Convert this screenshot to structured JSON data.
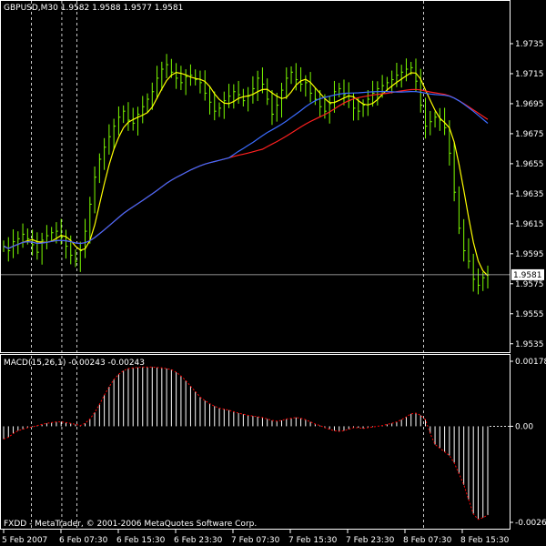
{
  "window_title": "GBPUSD,M30  1.9582 1.9588 1.9577 1.9581",
  "footer": "FXDD - MetaTrader, © 2001-2006 MetaQuotes Software Corp.",
  "colors": {
    "background": "#000000",
    "frame": "#ffffff",
    "bars": "#7CFC00",
    "ma_fast": "#ffff00",
    "ma_red": "#ff2020",
    "ma_blue": "#3b6cff",
    "macd_hist": "#ffffff",
    "macd_signal": "#ff0000",
    "current_price_line": "#c0c0c0",
    "grid_vlines": "#ffffff"
  },
  "chart_data": [
    {
      "type": "line",
      "title": "GBPUSD,M30  1.9582 1.9588 1.9577 1.9581",
      "ylim": [
        1.953,
        1.9755
      ],
      "y_ticks": [
        "1.9735",
        "1.9715",
        "1.9695",
        "1.9675",
        "1.9655",
        "1.9635",
        "1.9615",
        "1.9595",
        "1.9575",
        "1.9555",
        "1.9535"
      ],
      "current_price": "1.9581",
      "x_ticks": [
        "5 Feb 2007",
        "6 Feb 07:30",
        "6 Feb 15:30",
        "6 Feb 23:30",
        "7 Feb 07:30",
        "7 Feb 15:30",
        "7 Feb 23:30",
        "8 Feb 07:30",
        "8 Feb 15:30"
      ],
      "ohlc_close": [
        1.96,
        1.9597,
        1.9603,
        1.9605,
        1.9608,
        1.9605,
        1.9601,
        1.9596,
        1.9604,
        1.9607,
        1.9609,
        1.961,
        1.9606,
        1.96,
        1.9594,
        1.959,
        1.9597,
        1.961,
        1.9628,
        1.9646,
        1.9658,
        1.9666,
        1.9673,
        1.968,
        1.9686,
        1.969,
        1.9684,
        1.9682,
        1.9688,
        1.9693,
        1.9698,
        1.9703,
        1.9712,
        1.9718,
        1.9721,
        1.9716,
        1.9712,
        1.9709,
        1.9713,
        1.9714,
        1.9711,
        1.9709,
        1.9702,
        1.9696,
        1.969,
        1.9692,
        1.9697,
        1.97,
        1.9703,
        1.9701,
        1.9697,
        1.97,
        1.9705,
        1.9712,
        1.9708,
        1.9698,
        1.9688,
        1.9694,
        1.9704,
        1.9712,
        1.9716,
        1.9711,
        1.9708,
        1.9709,
        1.9702,
        1.9698,
        1.9693,
        1.969,
        1.9695,
        1.9703,
        1.9705,
        1.9701,
        1.9697,
        1.9692,
        1.969,
        1.9694,
        1.9698,
        1.9702,
        1.9705,
        1.9707,
        1.9709,
        1.9711,
        1.9714,
        1.9716,
        1.9718,
        1.9719,
        1.971,
        1.9694,
        1.968,
        1.9683,
        1.9686,
        1.9684,
        1.9679,
        1.9662,
        1.9636,
        1.9612,
        1.9597,
        1.959,
        1.9578,
        1.9574,
        1.9579,
        1.9581
      ],
      "bar_range": 0.0011,
      "series": [
        {
          "period": 5,
          "color_key": "ma_fast"
        },
        {
          "period": 55,
          "color_key": "ma_red"
        },
        {
          "period": 48,
          "color_key": "ma_blue"
        }
      ]
    },
    {
      "type": "bar",
      "title": "MACD(15,26,1) -0.00243 -0.00243",
      "ylim": [
        -0.00263,
        0.00178
      ],
      "y_ticks": [
        "0.00178",
        "0.00",
        "-0.00263"
      ],
      "histogram": [
        -0.00035,
        -0.0003,
        -0.0002,
        -0.00012,
        -8e-05,
        -4e-05,
        -2e-05,
        2e-05,
        5e-05,
        8e-05,
        0.0001,
        0.00012,
        0.00012,
        0.0001,
        8e-05,
        5e-05,
        2e-05,
        8e-05,
        0.0002,
        0.00038,
        0.0006,
        0.00085,
        0.00108,
        0.00128,
        0.00142,
        0.00152,
        0.00158,
        0.0016,
        0.00161,
        0.00162,
        0.00162,
        0.00162,
        0.00161,
        0.0016,
        0.00158,
        0.00155,
        0.00148,
        0.00138,
        0.00125,
        0.0011,
        0.00095,
        0.0008,
        0.0007,
        0.00062,
        0.00055,
        0.0005,
        0.00047,
        0.00044,
        0.0004,
        0.00036,
        0.00033,
        0.0003,
        0.00028,
        0.00026,
        0.00024,
        0.0002,
        0.00016,
        0.00014,
        0.00016,
        0.0002,
        0.00022,
        0.00024,
        0.00022,
        0.00018,
        0.00012,
        6e-05,
        2e-05,
        -4e-05,
        -8e-05,
        -0.00012,
        -0.00014,
        -0.00012,
        -8e-05,
        -4e-05,
        -4e-05,
        -6e-05,
        -4e-05,
        -2e-05,
        0.0,
        2e-05,
        5e-05,
        8e-05,
        0.00012,
        0.00018,
        0.00026,
        0.00034,
        0.00036,
        0.0003,
        0.00018,
        -0.0002,
        -0.0005,
        -0.0006,
        -0.0007,
        -0.0008,
        -0.001,
        -0.0013,
        -0.0016,
        -0.002,
        -0.0024,
        -0.00255,
        -0.0025,
        -0.00243
      ]
    }
  ]
}
